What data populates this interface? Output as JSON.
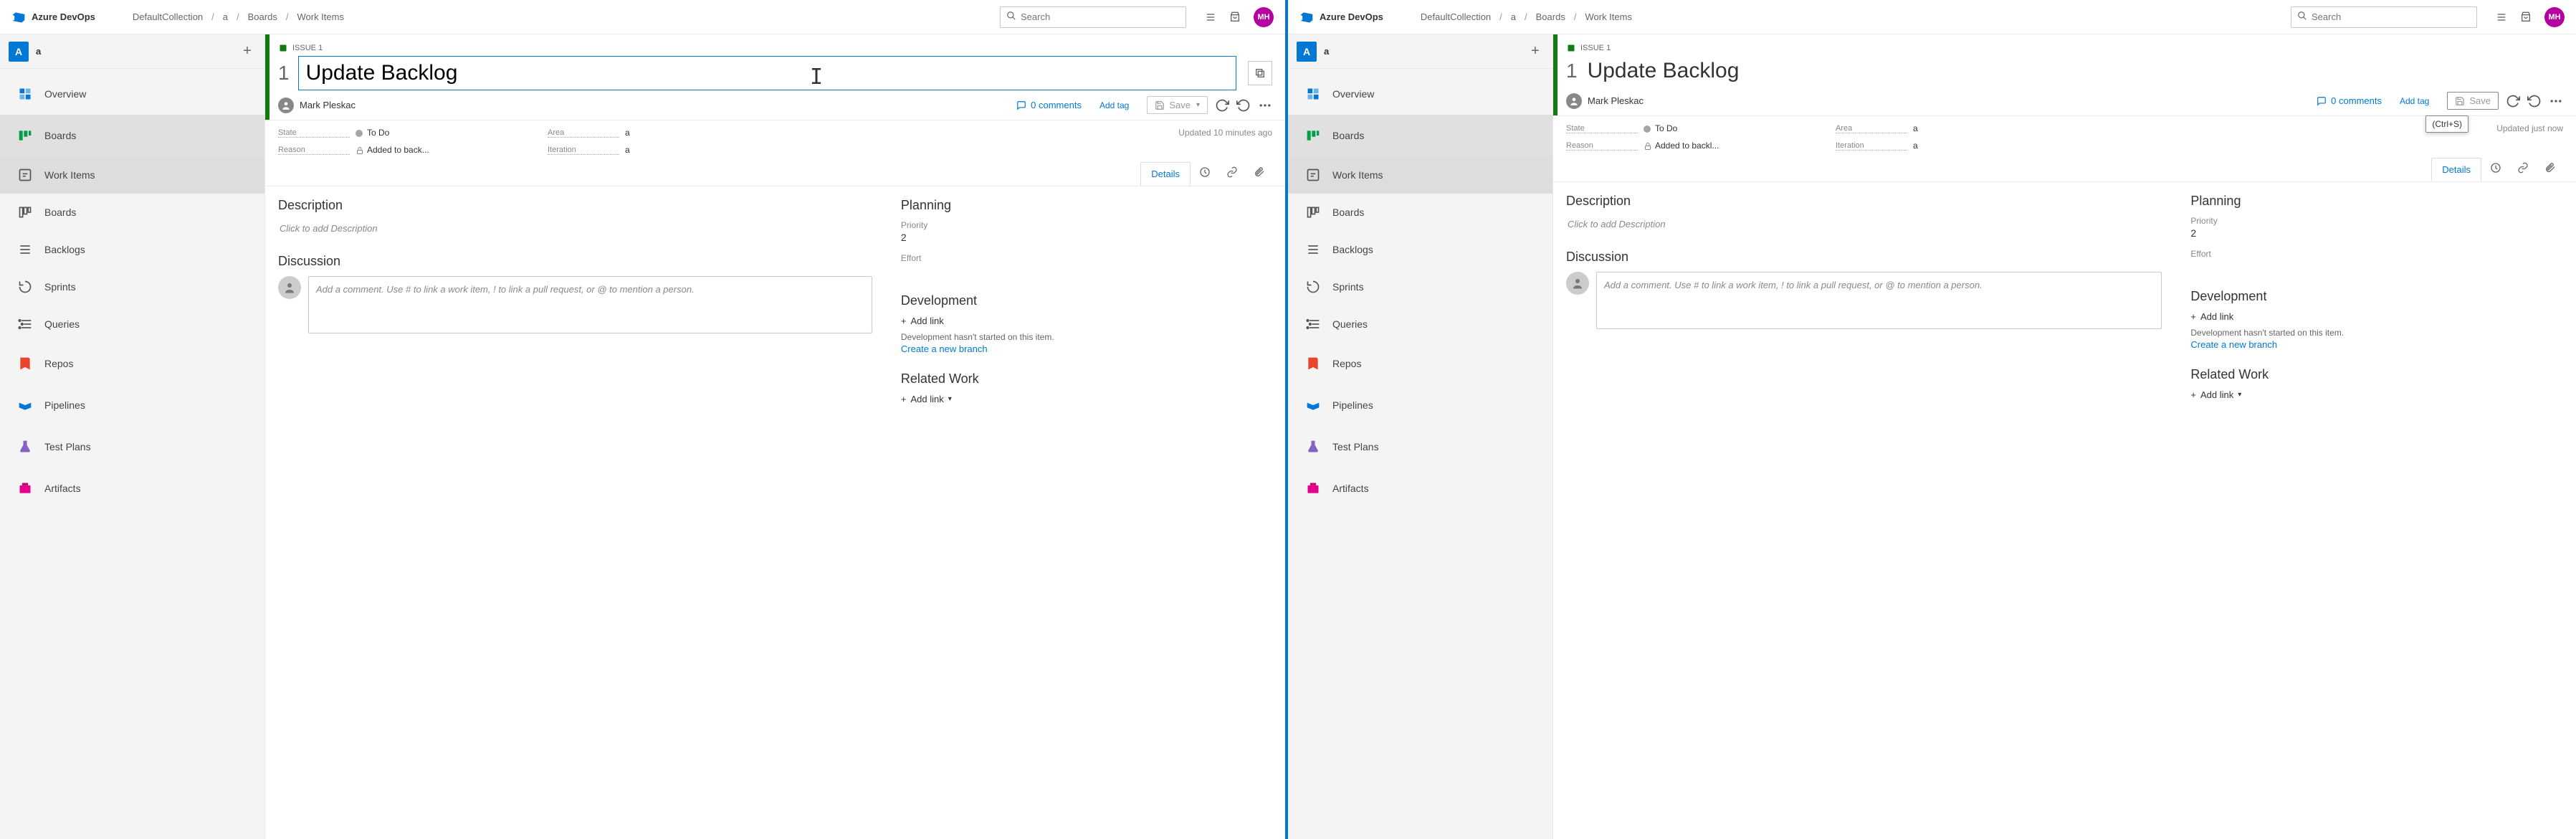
{
  "brand": "Azure DevOps",
  "breadcrumb": [
    "DefaultCollection",
    "a",
    "Boards",
    "Work Items"
  ],
  "search_placeholder": "Search",
  "avatar_initials": "MH",
  "project_letter": "A",
  "project_name": "a",
  "nav": {
    "overview": "Overview",
    "boards": "Boards",
    "work_items": "Work Items",
    "boards_sub": "Boards",
    "backlogs": "Backlogs",
    "sprints": "Sprints",
    "queries": "Queries",
    "repos": "Repos",
    "pipelines": "Pipelines",
    "test_plans": "Test Plans",
    "artifacts": "Artifacts"
  },
  "workitem": {
    "type_label": "ISSUE 1",
    "id": "1",
    "title": "Update Backlog",
    "assignee": "Mark Pleskac",
    "comments_count": "0 comments",
    "add_tag": "Add tag",
    "save": "Save",
    "state_lbl": "State",
    "state_val": "To Do",
    "area_lbl": "Area",
    "area_val": "a",
    "reason_lbl": "Reason",
    "reason_val_left": "Added to back...",
    "reason_val_right": "Added to backl...",
    "iteration_lbl": "Iteration",
    "iteration_val": "a",
    "updated_left": "Updated 10 minutes ago",
    "updated_right": "Updated just now",
    "tooltip_save": "(Ctrl+S)"
  },
  "tabs": {
    "details": "Details"
  },
  "sections": {
    "description": "Description",
    "description_ph": "Click to add Description",
    "discussion": "Discussion",
    "discussion_ph": "Add a comment. Use # to link a work item, ! to link a pull request, or @ to mention a person.",
    "planning": "Planning",
    "priority_lbl": "Priority",
    "priority_val": "2",
    "effort_lbl": "Effort",
    "development": "Development",
    "add_link": "Add link",
    "dev_hint": "Development hasn't started on this item.",
    "create_branch": "Create a new branch",
    "related_work": "Related Work",
    "add_link_dd": "Add link"
  }
}
